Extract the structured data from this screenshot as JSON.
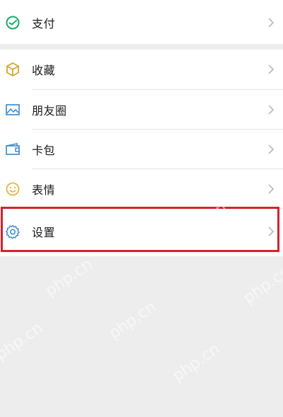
{
  "menu_top": [
    {
      "label": "支付",
      "icon": "wallet-check-icon"
    }
  ],
  "menu_main": [
    {
      "label": "收藏",
      "icon": "cube-icon"
    },
    {
      "label": "朋友圈",
      "icon": "picture-icon"
    },
    {
      "label": "卡包",
      "icon": "card-wallet-icon"
    },
    {
      "label": "表情",
      "icon": "smiley-icon"
    },
    {
      "label": "设置",
      "icon": "gear-icon"
    }
  ],
  "watermark": "php.cn",
  "colors": {
    "highlight": "#d3232b",
    "pay_icon": "#1aad6a",
    "accent_icon": "#3f8fd2",
    "favorite_icon": "#d4a630",
    "emoji_icon": "#e9b53a"
  }
}
